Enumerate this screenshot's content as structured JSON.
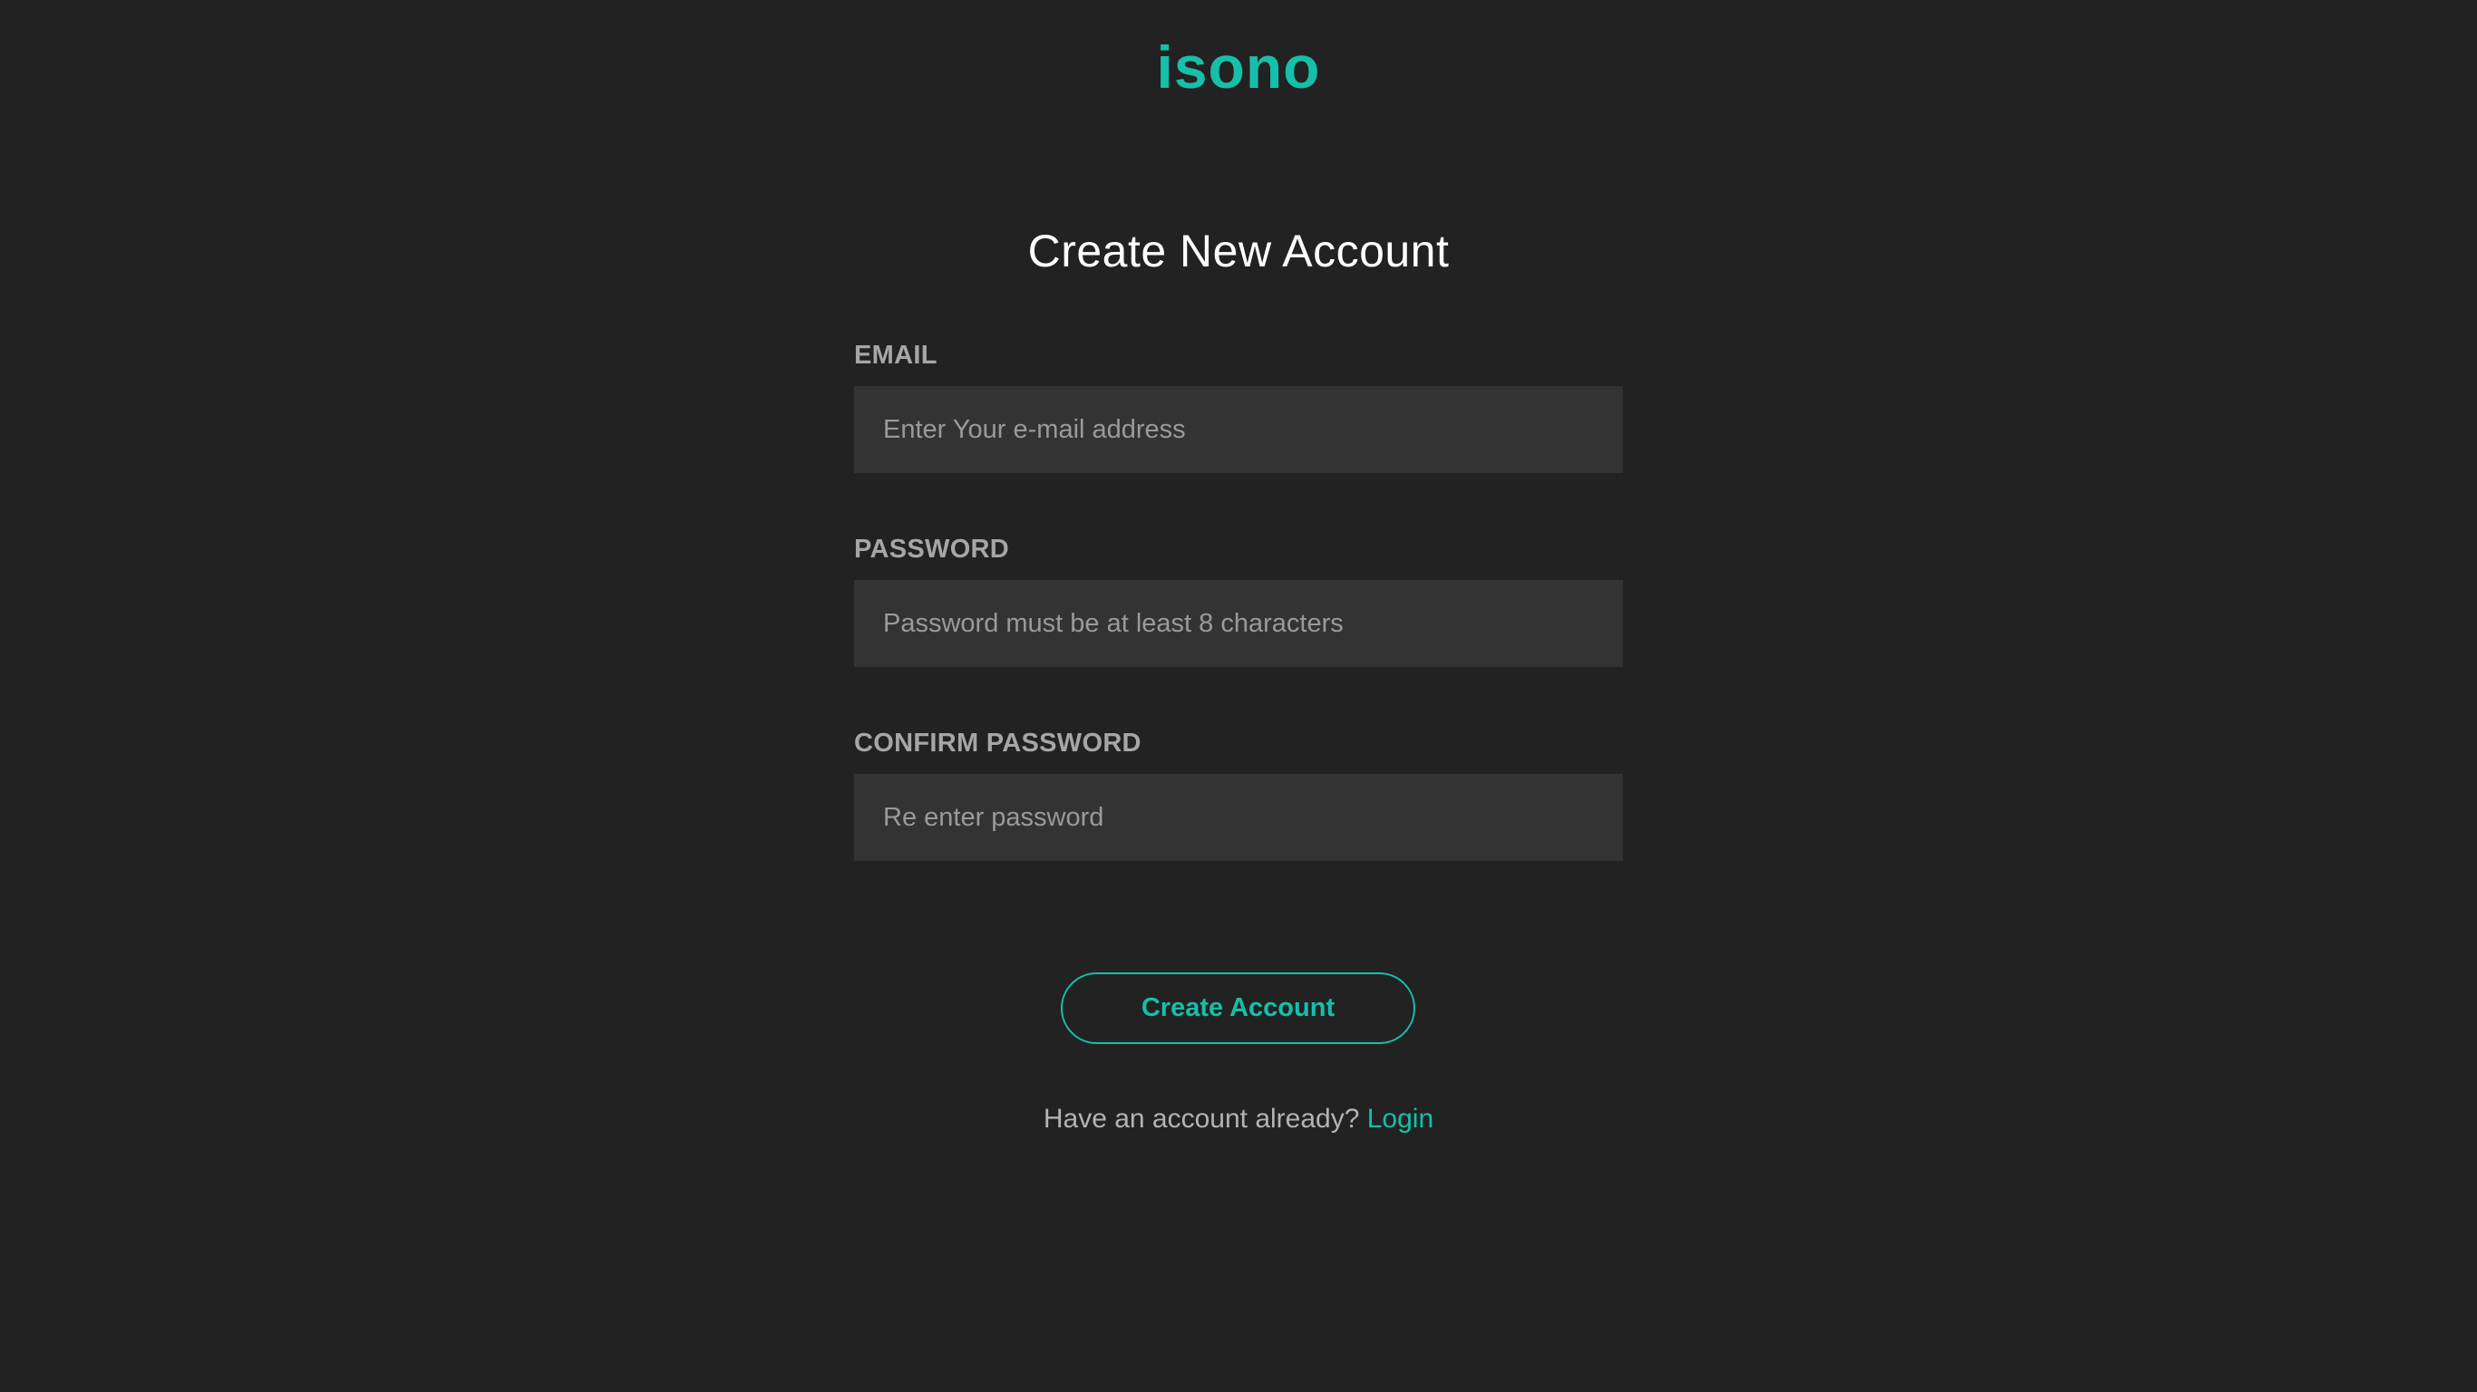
{
  "header": {
    "logo_text": "isono"
  },
  "form": {
    "title": "Create New Account",
    "email": {
      "label": "EMAIL",
      "value": "",
      "placeholder": "Enter Your e-mail address"
    },
    "password": {
      "label": "PASSWORD",
      "value": "",
      "placeholder": "Password must be at least 8 characters"
    },
    "confirm_password": {
      "label": "CONFIRM PASSWORD",
      "value": "",
      "placeholder": "Re enter password"
    },
    "submit_label": "Create Account"
  },
  "footer": {
    "prompt": "Have an account already?",
    "login_label": "Login"
  },
  "colors": {
    "background": "#222222",
    "accent": "#16bfa8",
    "input_background": "#333333",
    "label": "#a6a6a6"
  }
}
